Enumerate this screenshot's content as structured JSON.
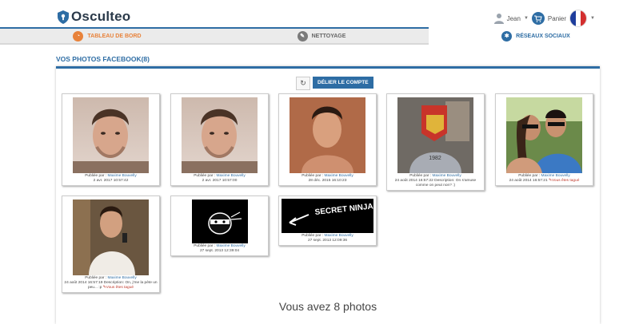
{
  "header": {
    "brand": "Osculteo",
    "user_name": "Jean",
    "cart_label": "Panier"
  },
  "tabs": [
    {
      "label": "TABLEAU DE BORD"
    },
    {
      "label": "NETTOYAGE"
    },
    {
      "label": "RÉSEAUX SOCIAUX"
    }
  ],
  "section": {
    "title": "VOS PHOTOS FACEBOOK(8)",
    "unlink_label": "DÉLIER LE COMPTE",
    "footer_count": "Vous avez 8 photos"
  },
  "photos": [
    {
      "published_by": "Publiée par :",
      "author": "Maxime Bouvelly",
      "date": "2 avr. 2017 10:57:42",
      "desc": "",
      "tag": ""
    },
    {
      "published_by": "Publiée par :",
      "author": "Maxime Bouvelly",
      "date": "2 avr. 2017 10:57:00",
      "desc": "",
      "tag": ""
    },
    {
      "published_by": "Publiée par :",
      "author": "Maxime Bouvelly",
      "date": "28 déc. 2015 16:10:23",
      "desc": "",
      "tag": ""
    },
    {
      "published_by": "Publiée par :",
      "author": "Maxime Bouvelly",
      "date": "24 août 2014 16:57:22",
      "desc": "Description: On s'amuse comme on peut non? :)",
      "tag": ""
    },
    {
      "published_by": "Publiée par :",
      "author": "Maxime Bouvelly",
      "date": "24 août 2014 16:57:21",
      "desc": "",
      "tag": "Vous êtes tagué"
    },
    {
      "published_by": "Publiée par :",
      "author": "Maxime Bouvelly",
      "date": "24 août 2014 16:57:19",
      "desc": "Description: On, j'me la pète un peu... :p",
      "tag": "Vous êtes tagué"
    },
    {
      "published_by": "Publiée par :",
      "author": "Maxime Bouvelly",
      "date": "27 sept. 2013 12:39:04",
      "desc": "",
      "tag": ""
    },
    {
      "published_by": "Publiée par :",
      "author": "Maxime Bouvelly",
      "date": "27 sept. 2013 12:09:36",
      "desc": "",
      "tag": ""
    }
  ],
  "ninja_text": "SECRET NINJA",
  "colors": {
    "accent": "#2e6da4",
    "dashboard": "#e8823a",
    "tagged": "#c0392b"
  }
}
